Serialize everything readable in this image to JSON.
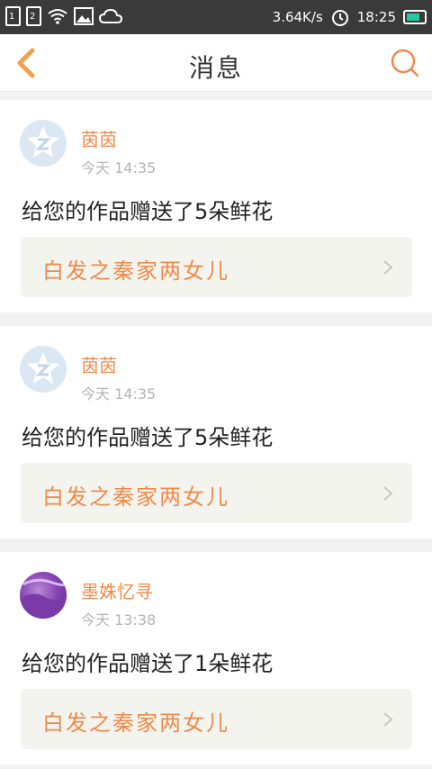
{
  "status_bar": {
    "sim1": "1",
    "sim2": "2",
    "speed": "3.64K/s",
    "time": "18:25"
  },
  "header": {
    "title": "消息",
    "back_icon": "chevron-left-icon",
    "search_icon": "search-icon"
  },
  "colors": {
    "accent": "#f08a4b",
    "status_bar_bg": "#3a3a3a",
    "battery": "#23c9a0"
  },
  "messages": [
    {
      "username": "茵茵",
      "time": "今天 14:35",
      "message": "给您的作品赠送了5朵鲜花",
      "work_title": "白发之秦家两女儿",
      "avatar": "default-avatar-icon"
    },
    {
      "username": "茵茵",
      "time": "今天 14:35",
      "message": "给您的作品赠送了5朵鲜花",
      "work_title": "白发之秦家两女儿",
      "avatar": "default-avatar-icon"
    },
    {
      "username": "墨姝忆寻",
      "time": "今天 13:38",
      "message": "给您的作品赠送了1朵鲜花",
      "work_title": "白发之秦家两女儿",
      "avatar": "photo-avatar"
    }
  ]
}
